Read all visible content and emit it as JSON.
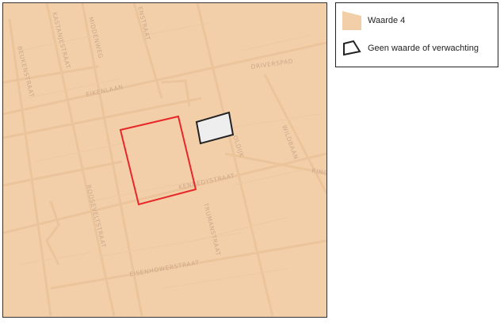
{
  "map": {
    "background_color": "#f2cfa8",
    "streets": [
      {
        "name": "BEUKENSTRAAT",
        "kind": "street-label"
      },
      {
        "name": "KASTANJESTRAAT",
        "kind": "street-label"
      },
      {
        "name": "MIDDENWEG",
        "kind": "street-label"
      },
      {
        "name": "ENSTRAAT",
        "kind": "street-label"
      },
      {
        "name": "DRIVERSPAD",
        "kind": "street-label"
      },
      {
        "name": "EIKENLAAN",
        "kind": "street-label"
      },
      {
        "name": "WILDBAAN",
        "kind": "street-label"
      },
      {
        "name": "OLDIJK",
        "kind": "street-label"
      },
      {
        "name": "RING",
        "kind": "street-label"
      },
      {
        "name": "KENNEDYSTRAAT",
        "kind": "street-label"
      },
      {
        "name": "TRUMANSTRAAT",
        "kind": "street-label"
      },
      {
        "name": "ROOSEVELTSTRAAT",
        "kind": "street-label"
      },
      {
        "name": "EISENHOWERSTRAAT",
        "kind": "street-label"
      }
    ],
    "features": [
      {
        "name": "project-area",
        "stroke_color": "#e8272a"
      },
      {
        "name": "no-value-parcel",
        "stroke_color": "#222222",
        "fill_color": "#eeeeee"
      }
    ]
  },
  "legend": {
    "items": [
      {
        "label": "Waarde 4",
        "swatch_color": "#f2cfa8",
        "icon": "filled-polygon-icon"
      },
      {
        "label": "Geen waarde of verwachting",
        "swatch_color": "#ffffff",
        "stroke_color": "#222222",
        "icon": "outline-polygon-icon"
      }
    ]
  }
}
